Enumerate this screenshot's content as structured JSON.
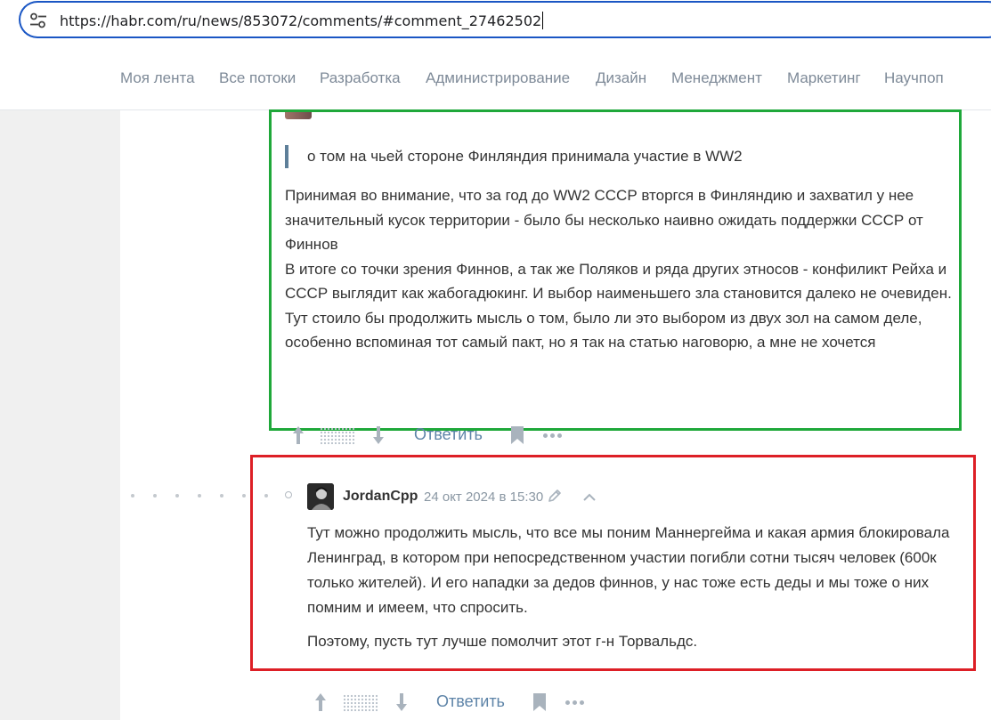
{
  "browser": {
    "url": "https://habr.com/ru/news/853072/comments/#comment_27462502"
  },
  "nav": {
    "items": [
      "Моя лента",
      "Все потоки",
      "Разработка",
      "Администрирование",
      "Дизайн",
      "Менеджмент",
      "Маркетинг",
      "Научпоп"
    ]
  },
  "comment1": {
    "quote": "о том на чьей стороне Финляндия принимала участие в WW2",
    "paragraphs": [
      "Принимая во внимание, что за год до WW2 СССР вторгся в Финляндию и захватил у нее значительный кусок территории - было бы несколько наивно ожидать поддержки СССР от Финнов",
      "В итоге со точки зрения Финнов, а так же Поляков и ряда других этносов - конфиликт Рейха и СССР выглядит как жабогадюкинг. И выбор наименьшего зла становится далеко не очевиден.",
      "Тут стоило бы продолжить мысль о том, было ли это выбором из двух зол на самом деле, особенно вспоминая тот самый пакт, но я так на статью наговорю, а мне не хочется"
    ],
    "reply_label": "Ответить",
    "highlight_color": "#1fa83a"
  },
  "comment2": {
    "username": "JordanCpp",
    "timestamp": "24 окт 2024 в 15:30",
    "paragraphs": [
      "Тут можно продолжить мысль, что все мы поним Маннергейма и какая армия блокировала Ленинград, в котором при непосредственном участии погибли сотни тысяч человек (600к только жителей). И его нападки за дедов финнов, у нас тоже есть деды и мы тоже о них помним и имеем, что спросить.",
      "Поэтому, пусть тут лучше помолчит этот г-н Торвальдс."
    ],
    "reply_label": "Ответить",
    "highlight_color": "#dd1f26"
  },
  "icons": {
    "url_bar": "tune-icon",
    "vote_up": "arrow-up-icon",
    "vote_down": "arrow-down-icon",
    "bookmark": "bookmark-icon",
    "more": "more-dots-icon",
    "edit": "pencil-icon",
    "collapse": "chevron-up-icon"
  },
  "colors": {
    "link": "#5e84a8",
    "nav_text": "#7e8a98",
    "url_border": "#1a56c4"
  }
}
